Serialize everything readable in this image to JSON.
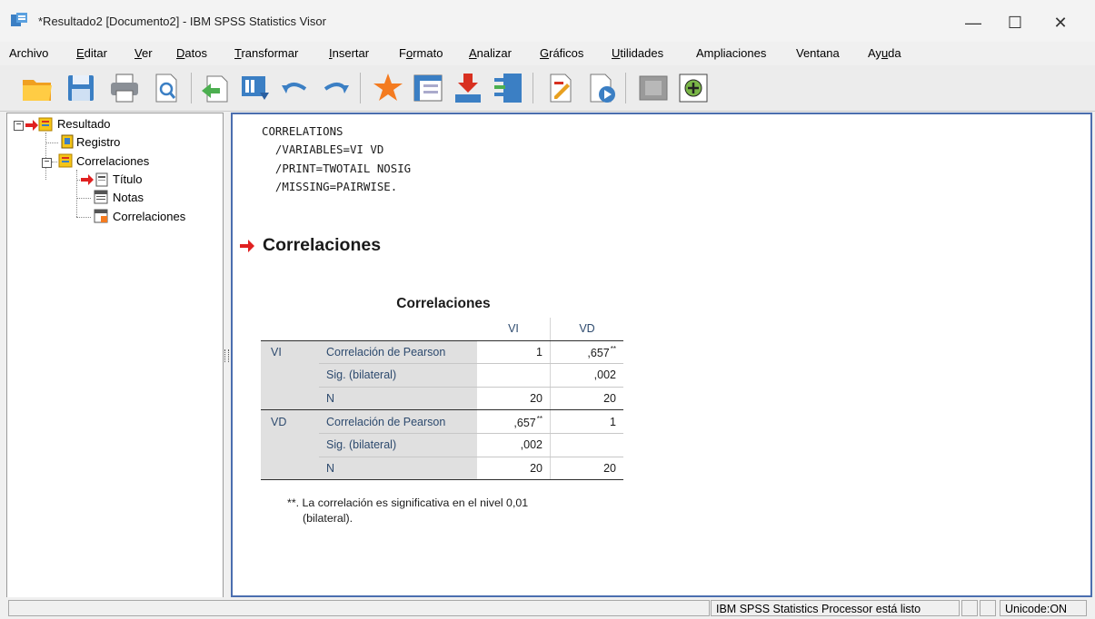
{
  "window": {
    "title": "*Resultado2 [Documento2] - IBM SPSS Statistics Visor",
    "minimize_glyph": "—",
    "maximize_glyph": "☐",
    "close_glyph": "✕"
  },
  "menu": {
    "items": [
      "Archivo",
      "Editar",
      "Ver",
      "Datos",
      "Transformar",
      "Insertar",
      "Formato",
      "Analizar",
      "Gráficos",
      "Utilidades",
      "Ampliaciones",
      "Ventana",
      "Ayuda"
    ]
  },
  "toolbar": {
    "buttons": [
      "open-icon",
      "save-icon",
      "print-icon",
      "print-preview-icon",
      "export-icon",
      "recall-dialog-icon",
      "undo-icon",
      "redo-icon",
      "goto-data-icon",
      "goto-case-icon",
      "variables-icon",
      "select-last-output-icon",
      "designate-window-icon",
      "create-title-icon",
      "run-script-icon",
      "grayed-icon",
      "add-icon"
    ]
  },
  "outline": {
    "root": "Resultado",
    "log": "Registro",
    "group": "Correlaciones",
    "children": [
      "Título",
      "Notas",
      "Correlaciones"
    ]
  },
  "syntax": {
    "lines": [
      "CORRELATIONS",
      "  /VARIABLES=VI VD",
      "  /PRINT=TWOTAIL NOSIG",
      "  /MISSING=PAIRWISE."
    ]
  },
  "output": {
    "heading": "Correlaciones",
    "table_title": "Correlaciones",
    "columns": [
      "VI",
      "VD"
    ],
    "rows": [
      {
        "var": "VI",
        "stat": "Correlación de Pearson",
        "vi": "1",
        "vd": ",657",
        "vd_sup": "**",
        "vi_sup": ""
      },
      {
        "var": "",
        "stat": "Sig. (bilateral)",
        "vi": "",
        "vd": ",002",
        "vd_sup": "",
        "vi_sup": ""
      },
      {
        "var": "",
        "stat": "N",
        "vi": "20",
        "vd": "20",
        "vd_sup": "",
        "vi_sup": ""
      },
      {
        "var": "VD",
        "stat": "Correlación de Pearson",
        "vi": ",657",
        "vd": "1",
        "vd_sup": "",
        "vi_sup": "**"
      },
      {
        "var": "",
        "stat": "Sig. (bilateral)",
        "vi": ",002",
        "vd": "",
        "vd_sup": "",
        "vi_sup": ""
      },
      {
        "var": "",
        "stat": "N",
        "vi": "20",
        "vd": "20",
        "vd_sup": "",
        "vi_sup": ""
      }
    ],
    "footnote_line1": "**. La correlación es significativa en el nivel 0,01",
    "footnote_line2": "(bilateral)."
  },
  "status": {
    "processor": "IBM SPSS Statistics Processor está listo",
    "unicode": "Unicode:ON"
  },
  "colors": {
    "pane_border": "#4b6eaf",
    "table_text": "#2d4a6e",
    "shaded_cell": "#e0e0e0",
    "arrow_red": "#e02020"
  }
}
